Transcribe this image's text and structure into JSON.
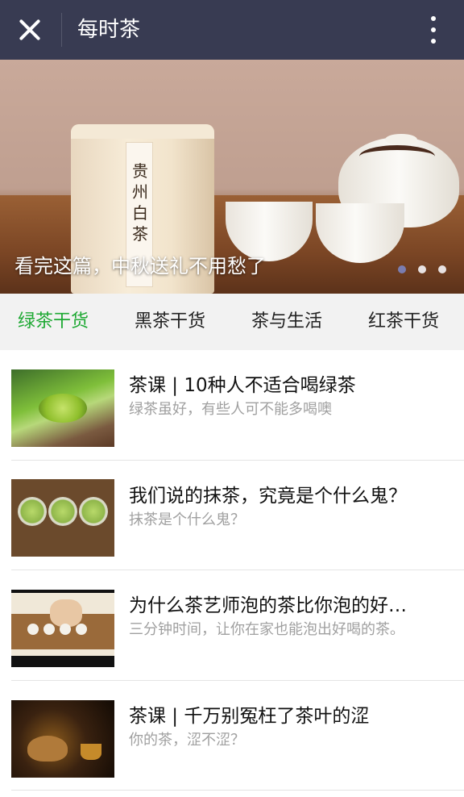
{
  "topbar": {
    "title": "每时茶",
    "close_icon": "close-icon",
    "more_icon": "more-vertical-icon",
    "background": "#383b52"
  },
  "banner": {
    "caption": "看完这篇，中秋送礼不用愁了",
    "can_label": "贵州白茶",
    "slide_count": 3,
    "active_slide": 1
  },
  "tabs": [
    {
      "label": "绿茶干货",
      "active": true
    },
    {
      "label": "黑茶干货",
      "active": false
    },
    {
      "label": "茶与生活",
      "active": false
    },
    {
      "label": "红茶干货",
      "active": false
    }
  ],
  "colors": {
    "accent_green": "#1fa934",
    "tab_bar_bg": "#f2f2f2",
    "desc_gray": "#a0a0a0"
  },
  "articles": [
    {
      "title": "茶课 | 10种人不适合喝绿茶",
      "description": "绿茶虽好，有些人可不能多喝噢"
    },
    {
      "title": "我们说的抹茶，究竟是个什么鬼？",
      "description": "抹茶是个什么鬼？"
    },
    {
      "title": "为什么茶艺师泡的茶比你泡的好…",
      "description": "三分钟时间，让你在家也能泡出好喝的茶。"
    },
    {
      "title": "茶课 | 千万别冤枉了茶叶的涩",
      "description": "你的茶，涩不涩？"
    }
  ]
}
